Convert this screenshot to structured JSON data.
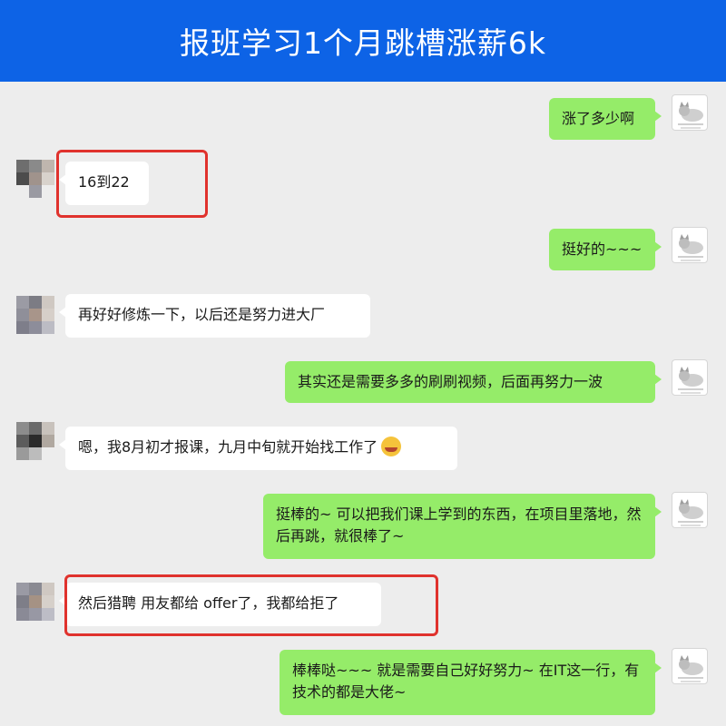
{
  "header": {
    "title": "报班学习1个月跳槽涨薪6k"
  },
  "messages": [
    {
      "side": "right",
      "text": "涨了多少啊"
    },
    {
      "side": "left",
      "text": "16到22"
    },
    {
      "side": "right",
      "text": "挺好的~~~"
    },
    {
      "side": "left",
      "text": "再好好修炼一下，以后还是努力进大厂"
    },
    {
      "side": "right",
      "text": "其实还是需要多多的刷刷视频，后面再努力一波"
    },
    {
      "side": "left",
      "text": "嗯，我8月初才报课，九月中旬就开始找工作了"
    },
    {
      "side": "right",
      "text": "挺棒的~ 可以把我们课上学到的东西，在项目里落地，然后再跳，就很棒了~"
    },
    {
      "side": "left",
      "text": "然后猎聘 用友都给 offer了，我都给拒了"
    },
    {
      "side": "right",
      "text": "棒棒哒~~~ 就是需要自己好好努力~  在IT这一行，有技术的都是大佬~"
    }
  ],
  "colors": {
    "header": "#0d63e6",
    "background": "#ededed",
    "right_bubble": "#95ec69",
    "left_bubble": "#ffffff",
    "highlight": "#e0322d"
  },
  "icons": {
    "sender_avatar": "cat-sticker-avatar",
    "contact_avatar": "pixelated-avatar",
    "emoji": "crying-laughing-emoji"
  }
}
